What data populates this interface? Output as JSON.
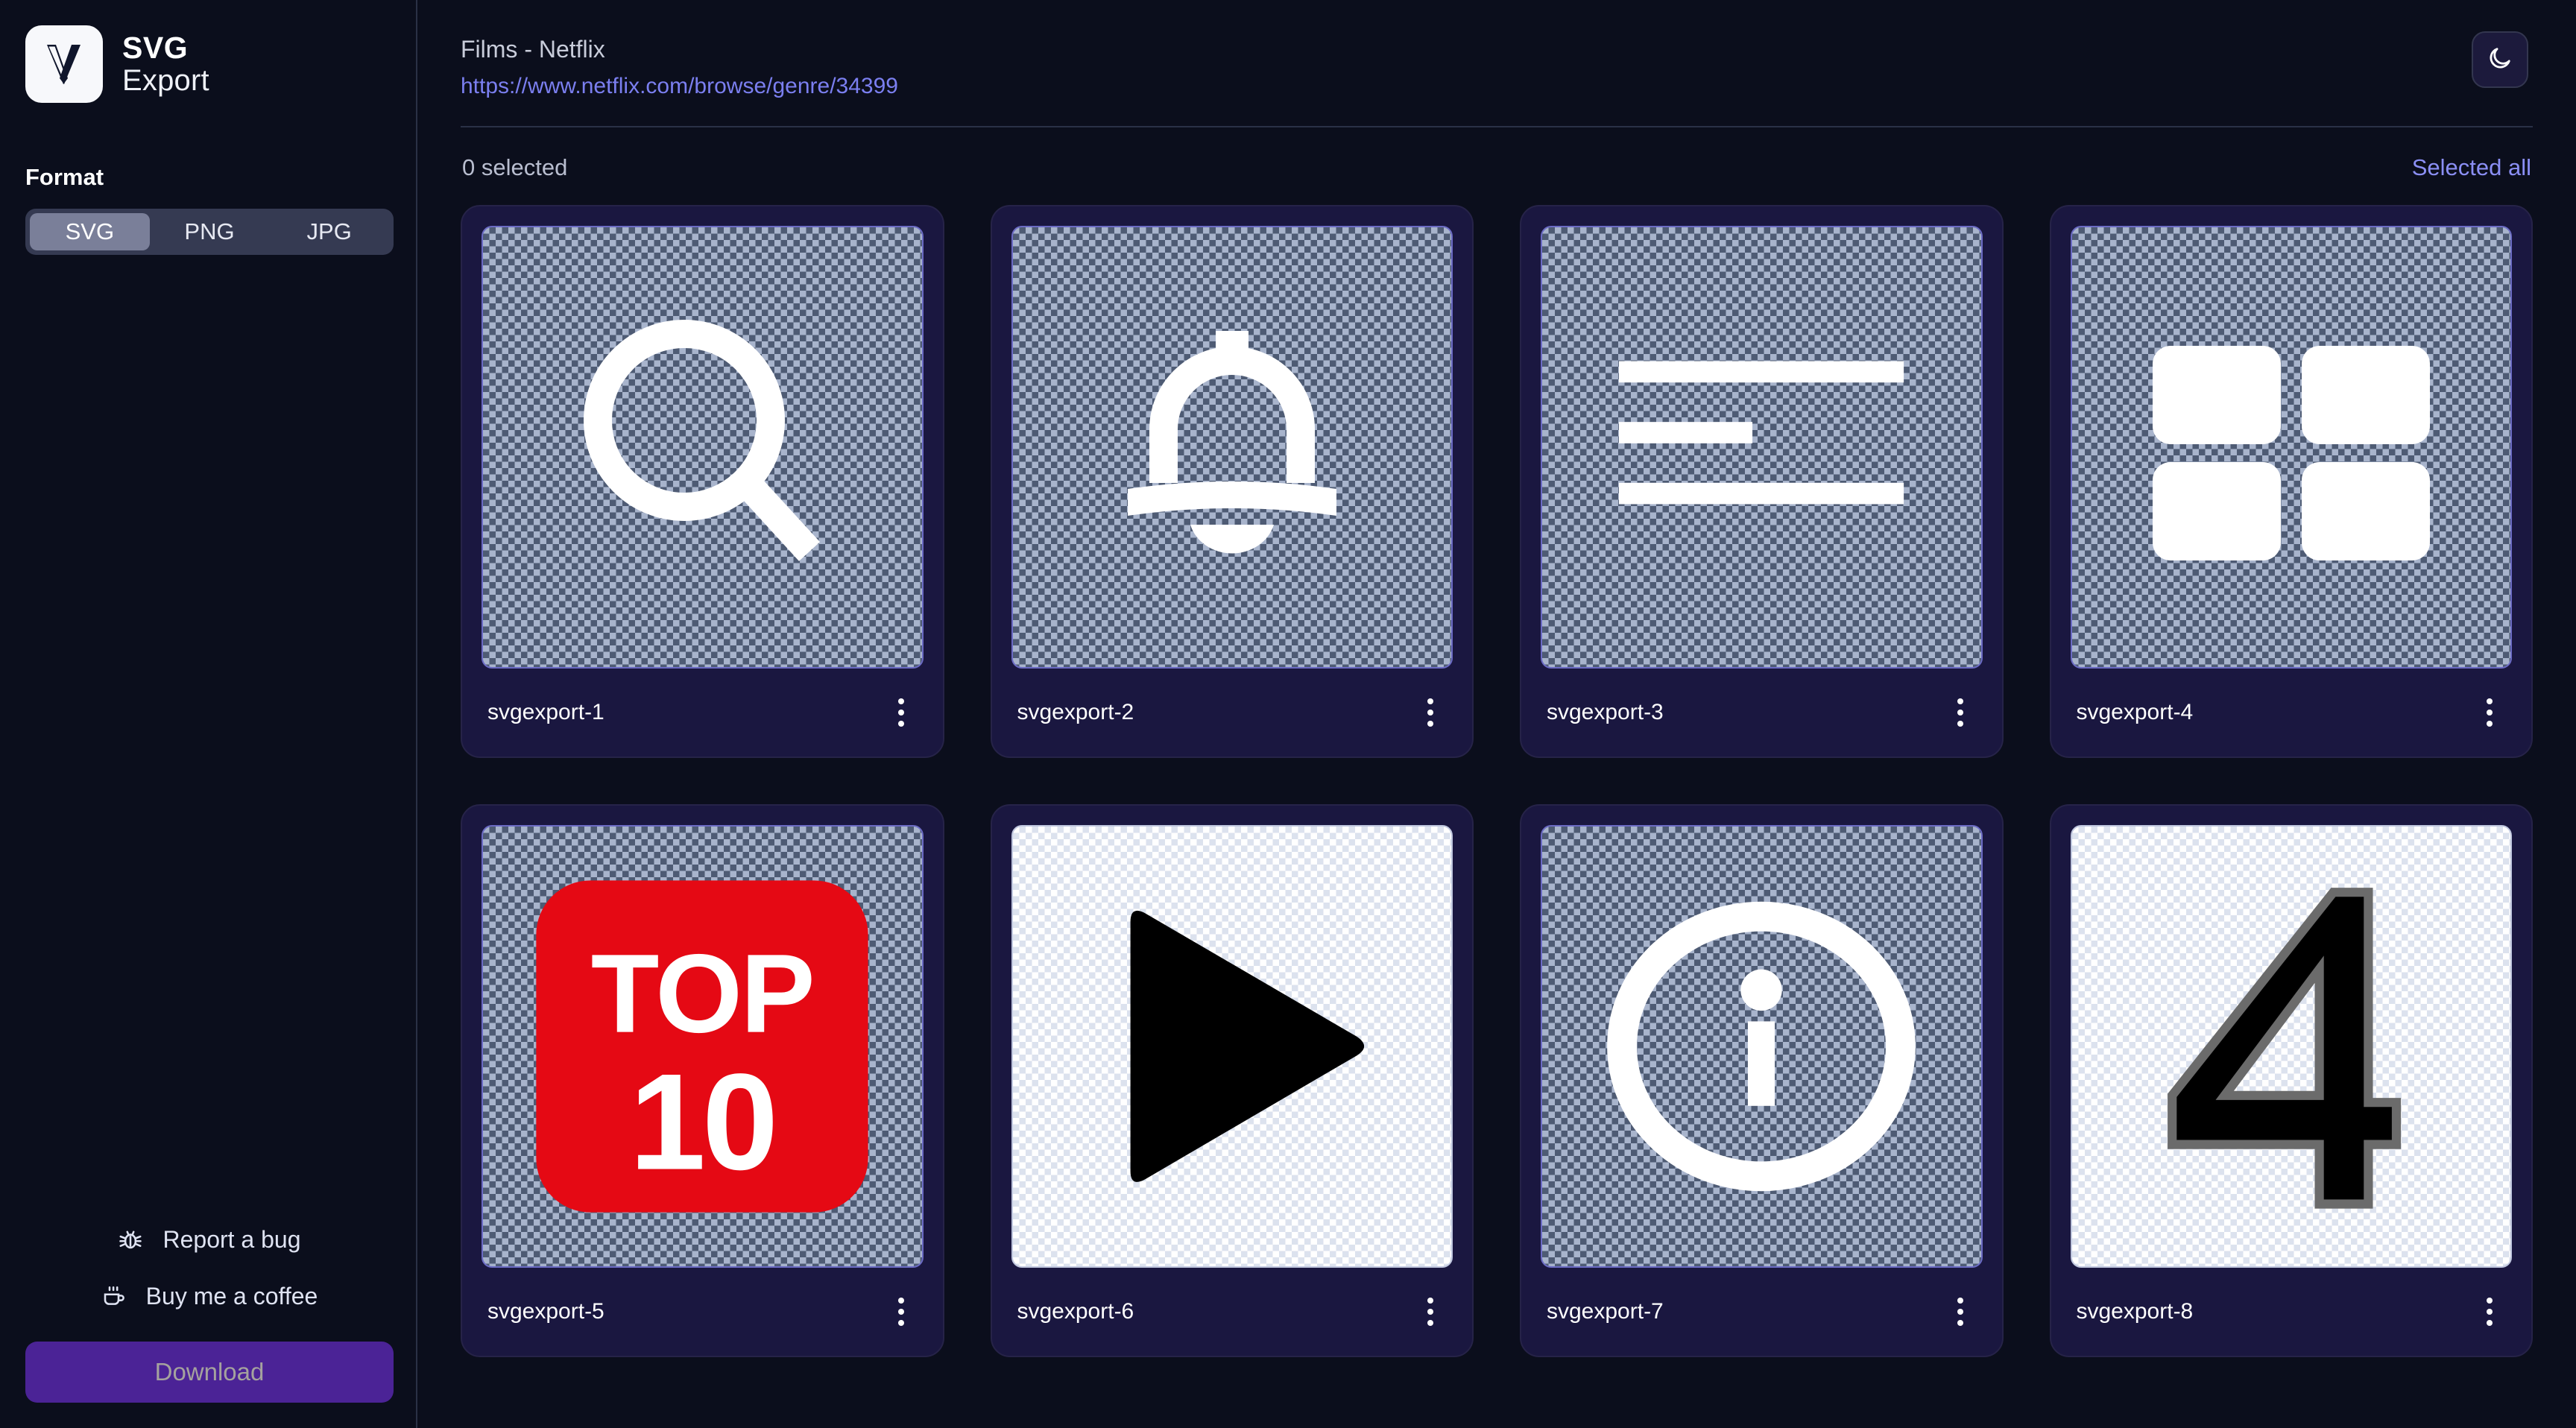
{
  "brand": {
    "logo_icon": "svgexport-v-logo",
    "name_line1": "SVG",
    "name_line2": "Export"
  },
  "sidebar": {
    "format_label": "Format",
    "format_options": [
      {
        "label": "SVG",
        "selected": true
      },
      {
        "label": "PNG",
        "selected": false
      },
      {
        "label": "JPG",
        "selected": false
      }
    ],
    "links": [
      {
        "label": "Report a bug",
        "icon": "bug-icon"
      },
      {
        "label": "Buy me a coffee",
        "icon": "coffee-icon"
      }
    ],
    "download_label": "Download",
    "download_enabled": false,
    "download_color": "#4b2396"
  },
  "header": {
    "page_title": "Films - Netflix",
    "page_url": "https://www.netflix.com/browse/genre/34399",
    "theme_toggle_icon": "moon-icon"
  },
  "toolbar": {
    "selected_count_label": "0 selected",
    "select_all_label": "Selected all",
    "select_all_color": "#8b8ff5"
  },
  "assets": [
    {
      "name": "svgexport-1",
      "icon": "magnifier-icon",
      "preview_theme": "dark",
      "menu_icon": "kebab-menu-icon"
    },
    {
      "name": "svgexport-2",
      "icon": "bell-icon",
      "preview_theme": "dark",
      "menu_icon": "kebab-menu-icon"
    },
    {
      "name": "svgexport-3",
      "icon": "list-lines-icon",
      "preview_theme": "dark",
      "menu_icon": "kebab-menu-icon"
    },
    {
      "name": "svgexport-4",
      "icon": "grid-four-icon",
      "preview_theme": "dark",
      "menu_icon": "kebab-menu-icon"
    },
    {
      "name": "svgexport-5",
      "icon": "top-10-badge-icon",
      "preview_theme": "dark",
      "menu_icon": "kebab-menu-icon",
      "badge_text_top": "TOP",
      "badge_text_bottom": "10",
      "badge_color": "#e50914"
    },
    {
      "name": "svgexport-6",
      "icon": "play-triangle-icon",
      "preview_theme": "light",
      "menu_icon": "kebab-menu-icon"
    },
    {
      "name": "svgexport-7",
      "icon": "info-circle-icon",
      "preview_theme": "dark",
      "menu_icon": "kebab-menu-icon"
    },
    {
      "name": "svgexport-8",
      "icon": "numeral-four-icon",
      "preview_theme": "light",
      "menu_icon": "kebab-menu-icon",
      "numeral": "4"
    }
  ],
  "colors": {
    "app_background": "#0b0e1c",
    "card_background": "#1a1740",
    "accent_link": "#7b7ff0",
    "checker_dark_light": "#a8b4cc",
    "checker_dark_dark": "#4e5b74",
    "checker_light_a": "#ffffff",
    "checker_light_b": "#dce2ee"
  }
}
